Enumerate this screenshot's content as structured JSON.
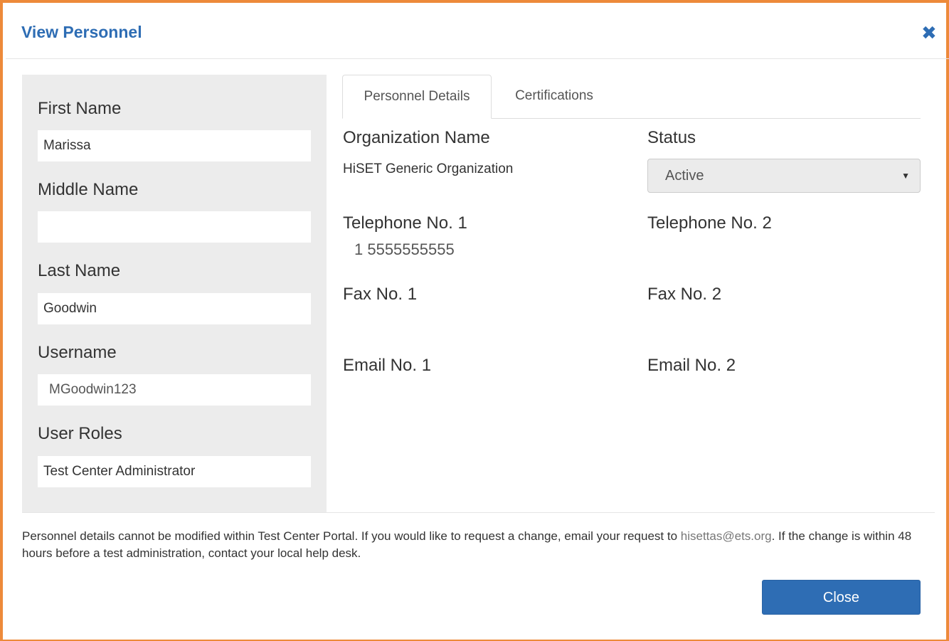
{
  "dialog": {
    "title": "View Personnel",
    "close_icon": "close-icon"
  },
  "left_panel": {
    "first_name_label": "First Name",
    "first_name_value": "Marissa",
    "middle_name_label": "Middle Name",
    "middle_name_value": "",
    "last_name_label": "Last Name",
    "last_name_value": "Goodwin",
    "username_label": "Username",
    "username_value": "MGoodwin123",
    "user_roles_label": "User Roles",
    "user_roles_value": "Test Center Administrator"
  },
  "tabs": [
    {
      "label": "Personnel Details",
      "active": true
    },
    {
      "label": "Certifications",
      "active": false
    }
  ],
  "details": {
    "organization_name_label": "Organization Name",
    "organization_name_value": "HiSET Generic Organization",
    "status_label": "Status",
    "status_value": "Active",
    "telephone1_label": "Telephone No. 1",
    "telephone1_value": "1 5555555555",
    "telephone2_label": "Telephone No. 2",
    "telephone2_value": "",
    "fax1_label": "Fax No. 1",
    "fax1_value": "",
    "fax2_label": "Fax No. 2",
    "fax2_value": "",
    "email1_label": "Email No. 1",
    "email1_value": "",
    "email2_label": "Email No. 2",
    "email2_value": ""
  },
  "footer": {
    "notice_part1": "Personnel details cannot be modified within Test Center Portal. If you would like to request a change, email your request to ",
    "notice_email": "hisettas@ets.org",
    "notice_part2": ". If the change is within 48 hours before a test administration, contact your local help desk.",
    "close_button_label": "Close"
  },
  "colors": {
    "frame_border": "#ed8a3a",
    "accent": "#2e6db4",
    "panel_bg": "#ececec"
  }
}
